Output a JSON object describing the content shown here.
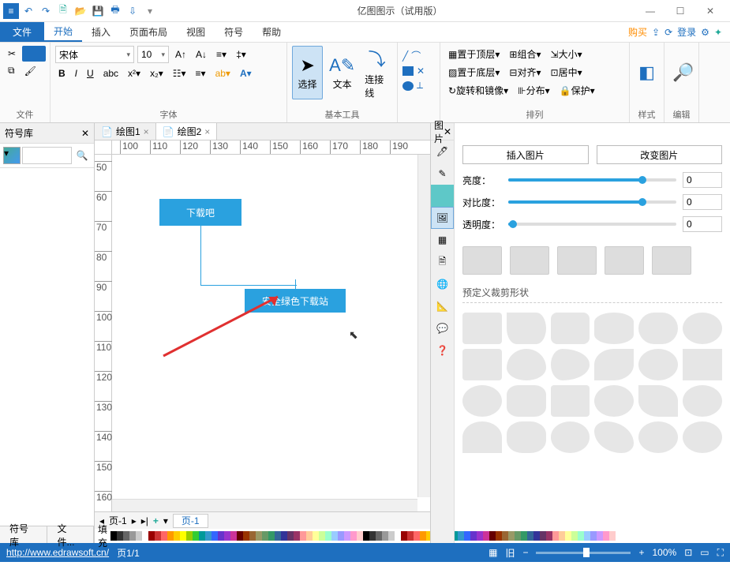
{
  "title": "亿图图示（试用版）",
  "qat_icons": [
    "menu-icon",
    "undo-icon",
    "redo-icon",
    "new-icon",
    "open-icon",
    "save-icon",
    "print-icon",
    "export-icon",
    "dropdown-icon"
  ],
  "ribbon_tabs": {
    "file": "文件",
    "items": [
      "开始",
      "插入",
      "页面布局",
      "视图",
      "符号",
      "帮助"
    ],
    "active": "开始"
  },
  "tabs_right": {
    "buy": "购买",
    "share": "↗",
    "refresh": "⟳",
    "login": "登录",
    "settings": "⚙",
    "apps": "✦"
  },
  "ribbon": {
    "file_group": "文件",
    "font_group": "字体",
    "font_name": "宋体",
    "font_size": "10",
    "tools_group": "基本工具",
    "tools": {
      "select": "选择",
      "text": "文本",
      "connector": "连接线"
    },
    "arrange_group": "排列",
    "arrange": {
      "top": "置于顶层",
      "bottom": "置于底层",
      "rotate": "旋转和镜像",
      "group": "组合",
      "align": "对齐",
      "distribute": "分布",
      "size": "大小",
      "center": "居中",
      "protect": "保护"
    },
    "style_group": "样式",
    "style_btn": "样式",
    "edit_group": "编辑",
    "find_btn": "编辑"
  },
  "symlib": {
    "title": "符号库",
    "search_placeholder": ""
  },
  "doc_tabs": [
    {
      "label": "绘图1"
    },
    {
      "label": "绘图2",
      "active": true
    }
  ],
  "ruler_h": [
    "100",
    "110",
    "120",
    "130",
    "140",
    "150",
    "160",
    "170",
    "180",
    "190"
  ],
  "ruler_v": [
    "50",
    "60",
    "70",
    "80",
    "90",
    "100",
    "110",
    "120",
    "130",
    "140",
    "150",
    "160"
  ],
  "nodes": {
    "n1": "下载吧",
    "n2": "安全绿色下载站"
  },
  "pagebar": {
    "nav": "页-1",
    "add": "+",
    "page_tab": "页-1",
    "fill": "填充"
  },
  "bottom_tabs": [
    "符号库",
    "文件..."
  ],
  "rightpanel": {
    "title": "图片",
    "buttons": {
      "insert": "插入图片",
      "change": "改变图片"
    },
    "sliders": [
      {
        "label": "亮度：",
        "value": "0",
        "pct": 80
      },
      {
        "label": "对比度：",
        "value": "0",
        "pct": 80
      },
      {
        "label": "透明度：",
        "value": "0",
        "pct": 3
      }
    ],
    "section": "预定义裁剪形状"
  },
  "status": {
    "url": "http://www.edrawsoft.cn/",
    "page": "页1/1",
    "zoom": "100%"
  }
}
